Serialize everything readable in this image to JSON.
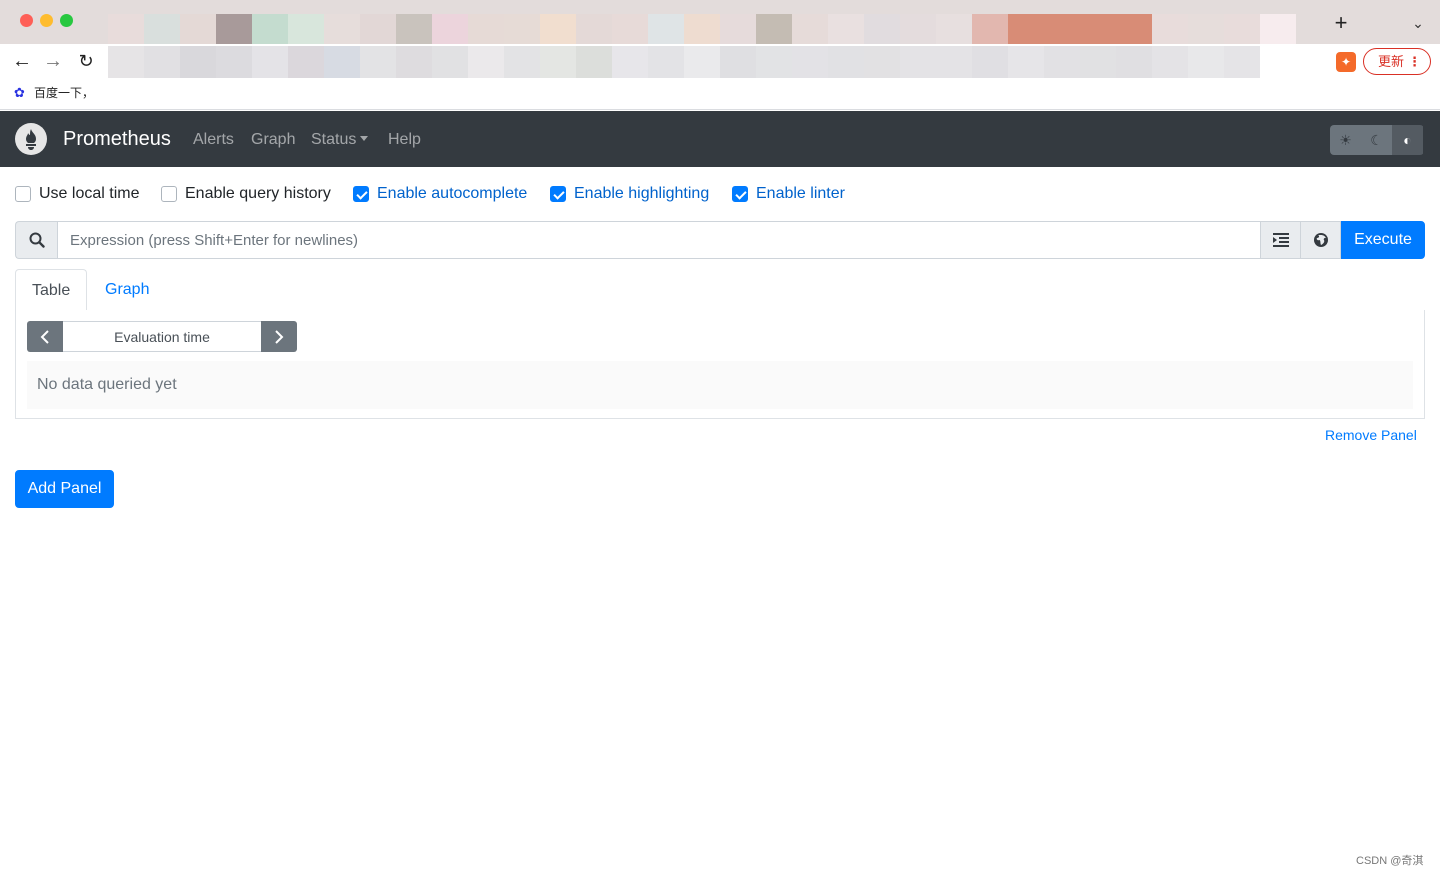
{
  "browser": {
    "new_tab_symbol": "+",
    "tab_menu_symbol": "⌄",
    "back_symbol": "←",
    "forward_symbol": "→",
    "reload_symbol": "↻",
    "update_label": "更新",
    "update_menu_symbol": "⋮",
    "bookmark_label": "百度一下，",
    "blur_colors_row1": [
      "#e8dcdb",
      "#d9dfdd",
      "#e4d9d6",
      "#a89a9a",
      "#c4dccf",
      "#d8e6dc",
      "#e6dddb",
      "#e2d7d6",
      "#c9c3bd",
      "#ecd4dc",
      "#e6dad6",
      "#e6dbd6",
      "#f1decf",
      "#e4d9d7",
      "#e7dad8",
      "#dfe4e6",
      "#eedcd0",
      "#e6dbdb",
      "#c4bcb3",
      "#e6dbd9",
      "#e9e0e0",
      "#e1dcdf",
      "#e4dcdd",
      "#e7dfdf",
      "#e2b7af",
      "#d88c76",
      "#d88c76",
      "#d88c76",
      "#d88c76",
      "#e8dcdb",
      "#e6dddb",
      "#e8dcdb",
      "#f7ecee"
    ],
    "blur_colors_row2": [
      "#e6e4e6",
      "#e1e0e3",
      "#d9d8dc",
      "#dcdbdf",
      "#e4e3e7",
      "#dbd7dc",
      "#d7dbe3",
      "#e3e3e5",
      "#dedcdf",
      "#e1e1e3",
      "#ebe9eb",
      "#e3e3e5",
      "#e4e6e3",
      "#dcdedb",
      "#e7e6ea",
      "#e3e3e6",
      "#eaeaec",
      "#dfdfe2",
      "#e2e3e5",
      "#e3e2e6",
      "#e1e1e4",
      "#e2e1e3",
      "#e4e3e6",
      "#e4e3e6",
      "#e0dfe3",
      "#e6e5e8",
      "#e2e1e4",
      "#e1e1e3",
      "#e0dfe2",
      "#e4e3e6",
      "#e8e8ea",
      "#e5e4e7",
      "#ffffff"
    ]
  },
  "navbar": {
    "brand": "Prometheus",
    "links": {
      "alerts": "Alerts",
      "graph": "Graph",
      "status": "Status",
      "help": "Help"
    },
    "theme": {
      "light_icon": "☀",
      "dark_icon": "☾",
      "auto_icon": "◐",
      "active": "auto"
    }
  },
  "options": {
    "use_local_time": {
      "label": "Use local time",
      "checked": false
    },
    "enable_query_history": {
      "label": "Enable query history",
      "checked": false
    },
    "enable_autocomplete": {
      "label": "Enable autocomplete",
      "checked": true
    },
    "enable_highlighting": {
      "label": "Enable highlighting",
      "checked": true
    },
    "enable_linter": {
      "label": "Enable linter",
      "checked": true
    }
  },
  "expression": {
    "value": "",
    "placeholder": "Expression (press Shift+Enter for newlines)",
    "format_icon": "☰",
    "metrics_explorer_icon": "◍",
    "execute_label": "Execute"
  },
  "panel": {
    "tabs": {
      "table": "Table",
      "graph": "Graph"
    },
    "active_tab": "table",
    "evaluation_time_placeholder": "Evaluation time",
    "prev_symbol": "‹",
    "next_symbol": "›",
    "empty_message": "No data queried yet",
    "remove_label": "Remove Panel"
  },
  "add_panel_label": "Add Panel",
  "watermark": "CSDN @奇淇"
}
